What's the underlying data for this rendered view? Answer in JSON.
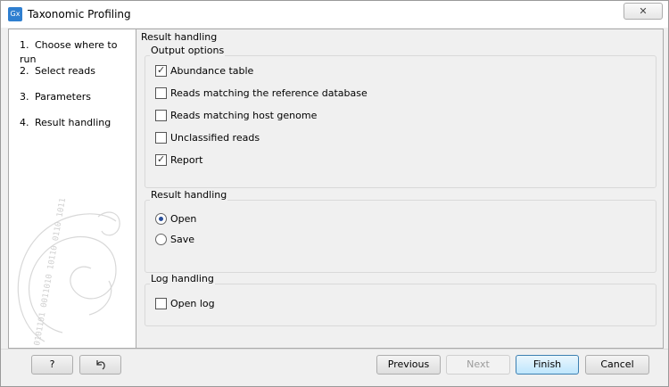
{
  "window": {
    "title": "Taxonomic Profiling",
    "app_icon_text": "Gx",
    "close_glyph": "✕"
  },
  "steps": [
    {
      "num": "1.",
      "label": "Choose where to run"
    },
    {
      "num": "2.",
      "label": "Select reads"
    },
    {
      "num": "3.",
      "label": "Parameters"
    },
    {
      "num": "4.",
      "label": "Result handling"
    }
  ],
  "content_title": "Result handling",
  "output_options": {
    "label": "Output options",
    "items": [
      {
        "label": "Abundance table",
        "checked": true
      },
      {
        "label": "Reads matching the reference database",
        "checked": false
      },
      {
        "label": "Reads matching host genome",
        "checked": false
      },
      {
        "label": "Unclassified reads",
        "checked": false
      },
      {
        "label": "Report",
        "checked": true
      }
    ]
  },
  "result_handling": {
    "label": "Result handling",
    "options": [
      {
        "label": "Open",
        "selected": true
      },
      {
        "label": "Save",
        "selected": false
      }
    ]
  },
  "log_handling": {
    "label": "Log handling",
    "open_log": {
      "label": "Open log",
      "checked": false
    }
  },
  "buttons": {
    "help": "?",
    "reset_icon": "reset-arrow-icon",
    "previous": "Previous",
    "next": "Next",
    "finish": "Finish",
    "cancel": "Cancel"
  },
  "check_glyph": "✓",
  "swirl_text": "0101101 0011010 10110 0110 1011 010"
}
